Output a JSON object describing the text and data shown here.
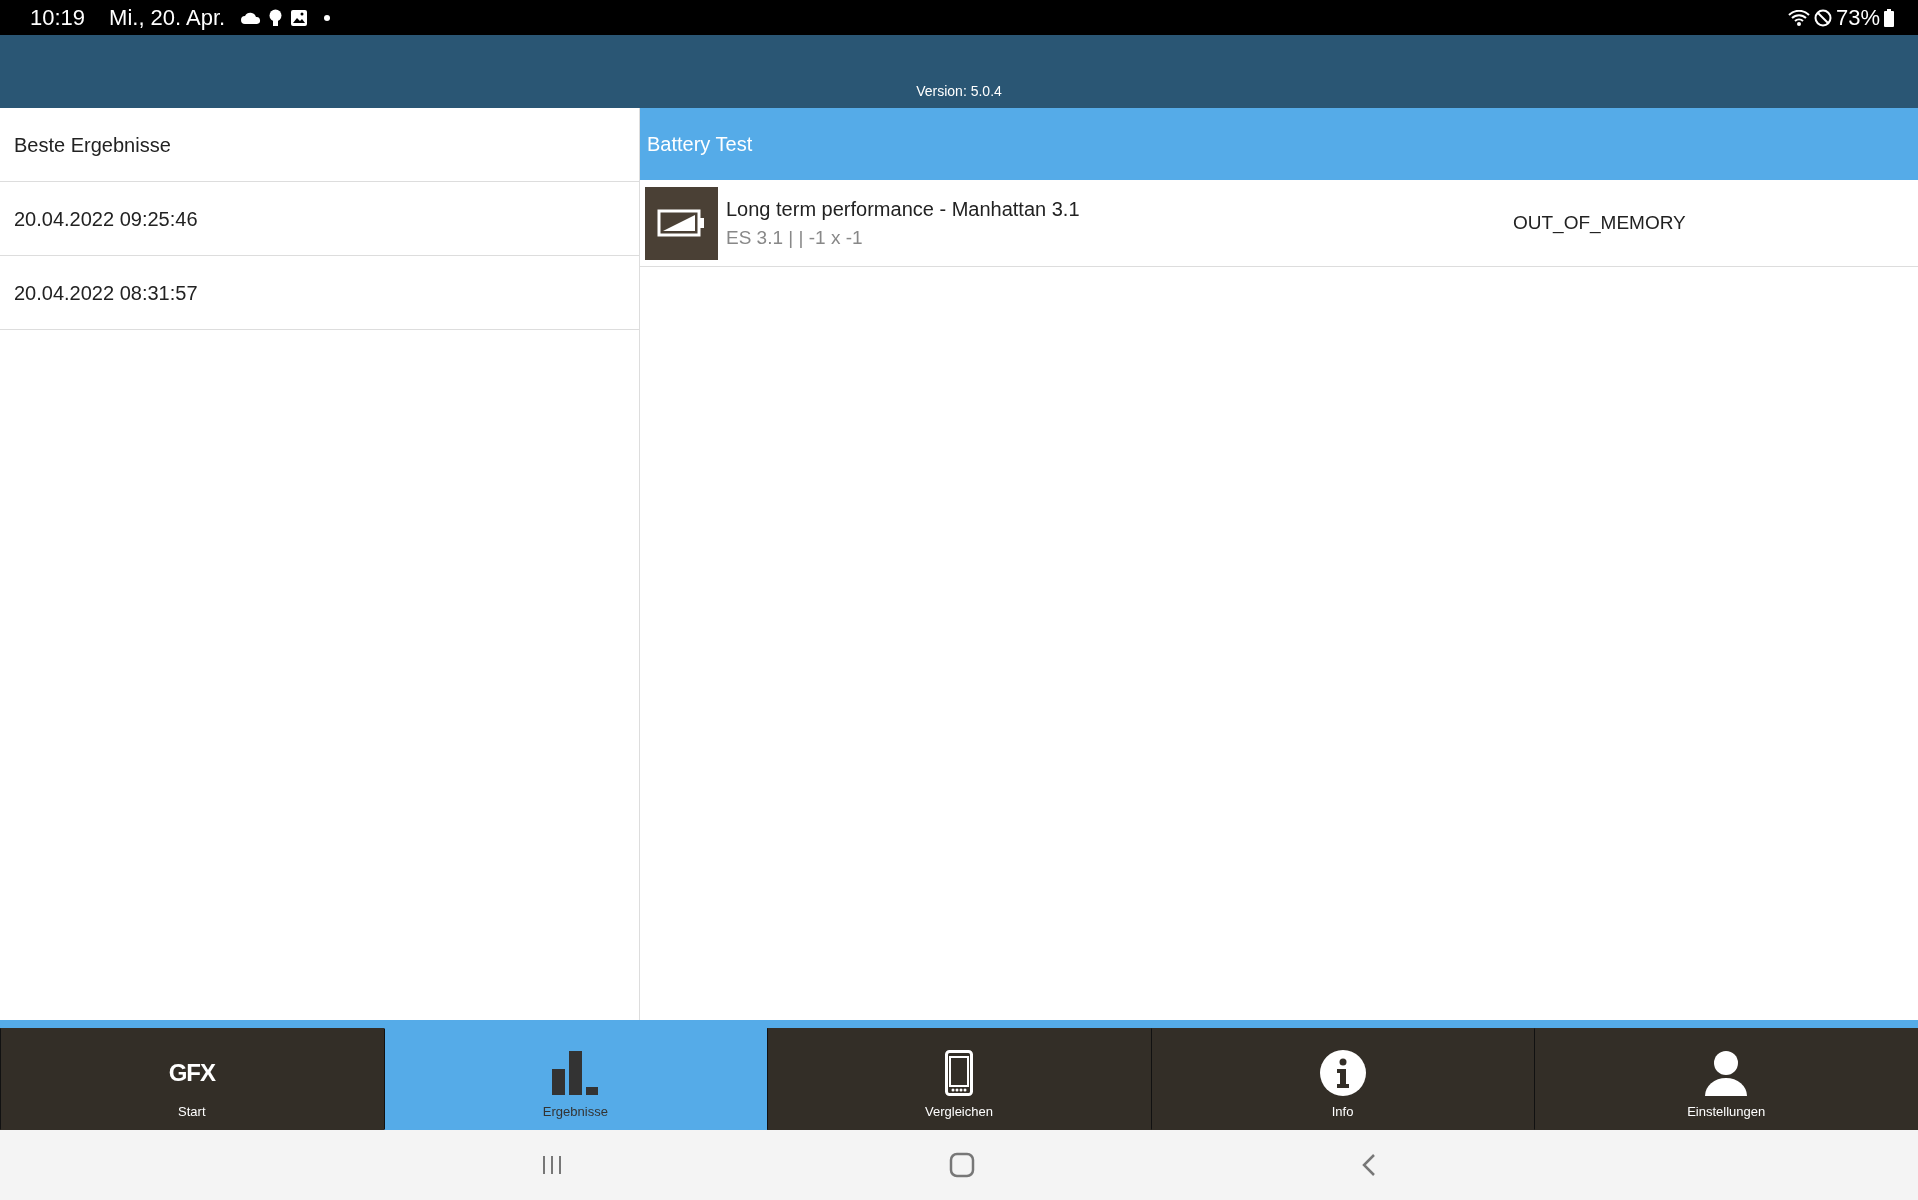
{
  "status_bar": {
    "time": "10:19",
    "date": "Mi., 20. Apr.",
    "battery": "73%"
  },
  "header": {
    "version": "Version: 5.0.4"
  },
  "results_list": [
    "Beste Ergebnisse",
    "20.04.2022 09:25:46",
    "20.04.2022 08:31:57"
  ],
  "detail": {
    "title": "Battery Test",
    "rows": [
      {
        "name": "Long term performance - Manhattan 3.1",
        "info": "ES 3.1 |  | -1 x -1",
        "result": "OUT_OF_MEMORY"
      }
    ]
  },
  "tabs": [
    {
      "kind": "logo",
      "logo": "GFX",
      "label": "Start",
      "selected": false
    },
    {
      "kind": "chart",
      "label": "Ergebnisse",
      "selected": true
    },
    {
      "kind": "phone",
      "label": "Vergleichen",
      "selected": false
    },
    {
      "kind": "info",
      "label": "Info",
      "selected": false
    },
    {
      "kind": "person",
      "label": "Einstellungen",
      "selected": false
    }
  ]
}
